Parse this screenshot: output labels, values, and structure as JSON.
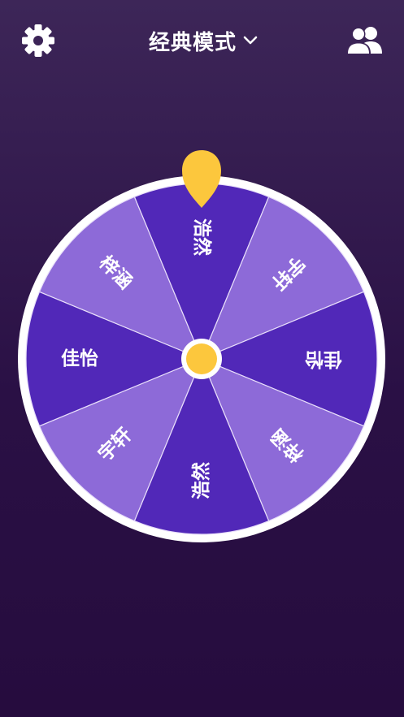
{
  "header": {
    "mode_title": "经典模式",
    "settings_icon": "gear-icon",
    "dropdown_icon": "chevron-down-icon",
    "players_icon": "users-icon"
  },
  "wheel": {
    "segments": [
      {
        "label": "浩然",
        "color": "#5128b8"
      },
      {
        "label": "宇轩",
        "color": "#8d6ad8"
      },
      {
        "label": "佳怡",
        "color": "#5128b8"
      },
      {
        "label": "梓涵",
        "color": "#8d6ad8"
      },
      {
        "label": "浩然",
        "color": "#5128b8"
      },
      {
        "label": "宇轩",
        "color": "#8d6ad8"
      },
      {
        "label": "佳怡",
        "color": "#5128b8"
      },
      {
        "label": "梓涵",
        "color": "#8d6ad8"
      }
    ],
    "rim_color": "#ffffff",
    "hub_color": "#fcc73d",
    "pointer_color": "#fcc73d"
  }
}
